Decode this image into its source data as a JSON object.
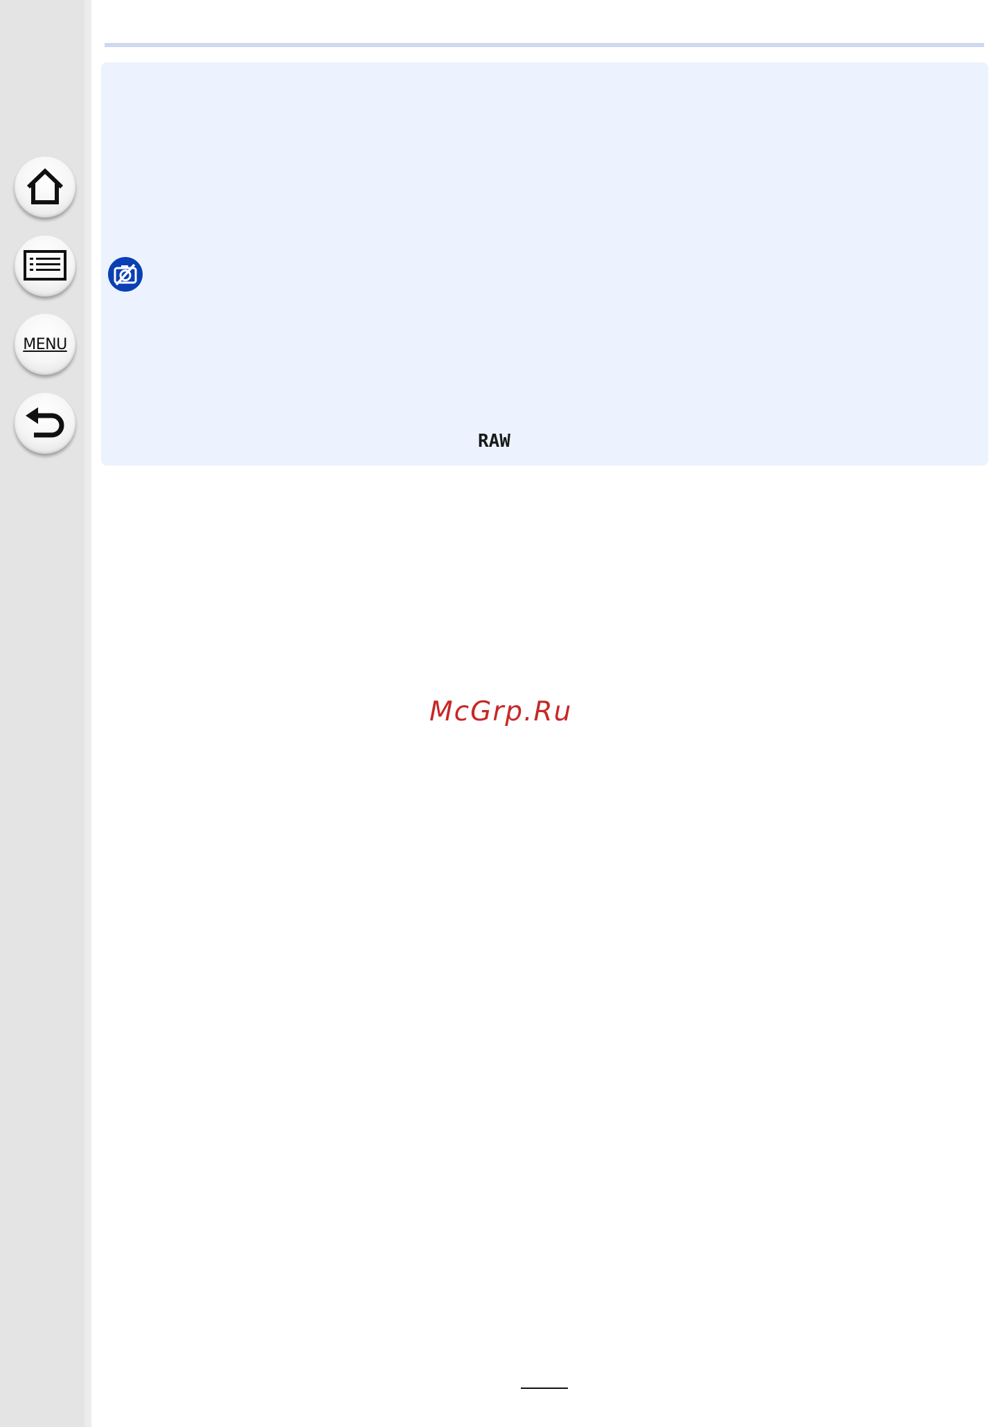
{
  "nav": {
    "home_icon": "home-icon",
    "contents_icon": "contents-list-icon",
    "menu_label": "MENU",
    "back_icon": "back-arrow-icon"
  },
  "info_box": {
    "icon": "no-camera-icon",
    "raw_label": "RAW"
  },
  "watermark": "McGrp.Ru",
  "colors": {
    "sidebar": "#e4e4e4",
    "info_box_bg": "#ecf3fe",
    "top_rule": "#cdd8f2",
    "icon_blue": "#0a3fb5",
    "watermark": "#c62828"
  }
}
